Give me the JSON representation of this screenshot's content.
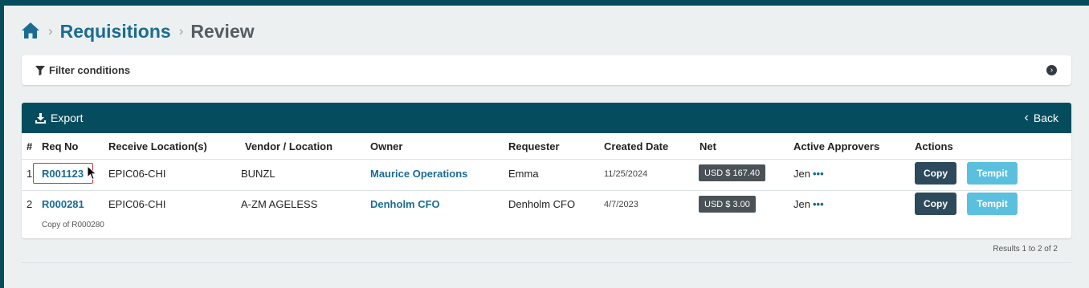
{
  "breadcrumb": {
    "parent": "Requisitions",
    "current": "Review"
  },
  "filter": {
    "label": "Filter conditions"
  },
  "toolbar": {
    "export_label": "Export",
    "back_label": "Back"
  },
  "table": {
    "headers": {
      "num": "#",
      "req_no": "Req No",
      "receive_location": "Receive Location(s)",
      "vendor": "Vendor / Location",
      "owner": "Owner",
      "requester": "Requester",
      "created": "Created Date",
      "net": "Net",
      "approvers": "Active Approvers",
      "actions": "Actions"
    },
    "rows": [
      {
        "num": "1",
        "req_no": "R001123",
        "receive_location": "EPIC06-CHI",
        "vendor": "BUNZL",
        "owner": "Maurice Operations",
        "requester": "Emma",
        "created": "11/25/2024",
        "net": "USD $ 167.40",
        "approver": "Jen",
        "approver_more": "•••",
        "copy_label": "Copy",
        "tempit_label": "Tempit"
      },
      {
        "num": "2",
        "req_no": "R000281",
        "receive_location": "EPIC06-CHI",
        "vendor": "A-ZM AGELESS",
        "owner": "Denholm CFO",
        "requester": "Denholm CFO",
        "created": "4/7/2023",
        "net": "USD $ 3.00",
        "approver": "Jen",
        "approver_more": "•••",
        "copy_label": "Copy",
        "tempit_label": "Tempit",
        "note": "Copy of R000280"
      }
    ],
    "results": "Results 1 to 2 of 2"
  },
  "colors": {
    "header_bar": "#064c5f",
    "link": "#1a6c93",
    "copy_button": "#2d4a5c",
    "tempit_button": "#5bc0de",
    "badge": "#4a5257",
    "highlight": "#d9343c"
  },
  "icons": [
    "home-icon",
    "chevron-right-icon",
    "filter-icon",
    "chevron-circle-icon",
    "download-icon",
    "chevron-left-icon",
    "more-dots-icon",
    "mouse-cursor-icon"
  ]
}
